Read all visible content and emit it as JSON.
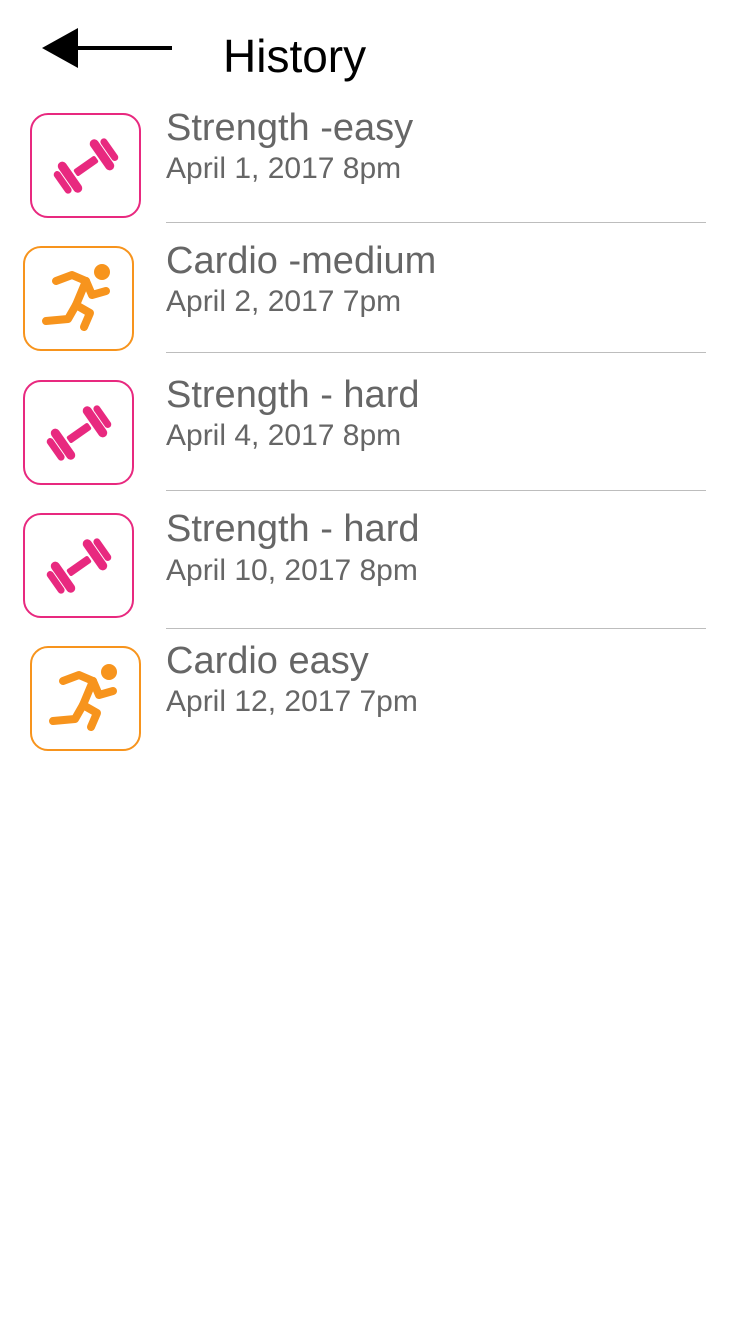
{
  "header": {
    "back_icon": "arrow-left-icon",
    "title": "History"
  },
  "colors": {
    "strength": "#e8297f",
    "cardio": "#f7941d",
    "text": "#666666",
    "divider": "#bdbdbd"
  },
  "history": {
    "items": [
      {
        "type": "strength",
        "icon": "dumbbell-icon",
        "title": "Strength -easy",
        "date": "April 1, 2017 8pm"
      },
      {
        "type": "cardio",
        "icon": "runner-icon",
        "title": "Cardio -medium",
        "date": "April 2, 2017 7pm"
      },
      {
        "type": "strength",
        "icon": "dumbbell-icon",
        "title": "Strength - hard",
        "date": "April 4, 2017 8pm"
      },
      {
        "type": "strength",
        "icon": "dumbbell-icon",
        "title": "Strength - hard",
        "date": "April 10, 2017 8pm"
      },
      {
        "type": "cardio",
        "icon": "runner-icon",
        "title": "Cardio easy",
        "date": "April 12, 2017 7pm"
      }
    ]
  }
}
